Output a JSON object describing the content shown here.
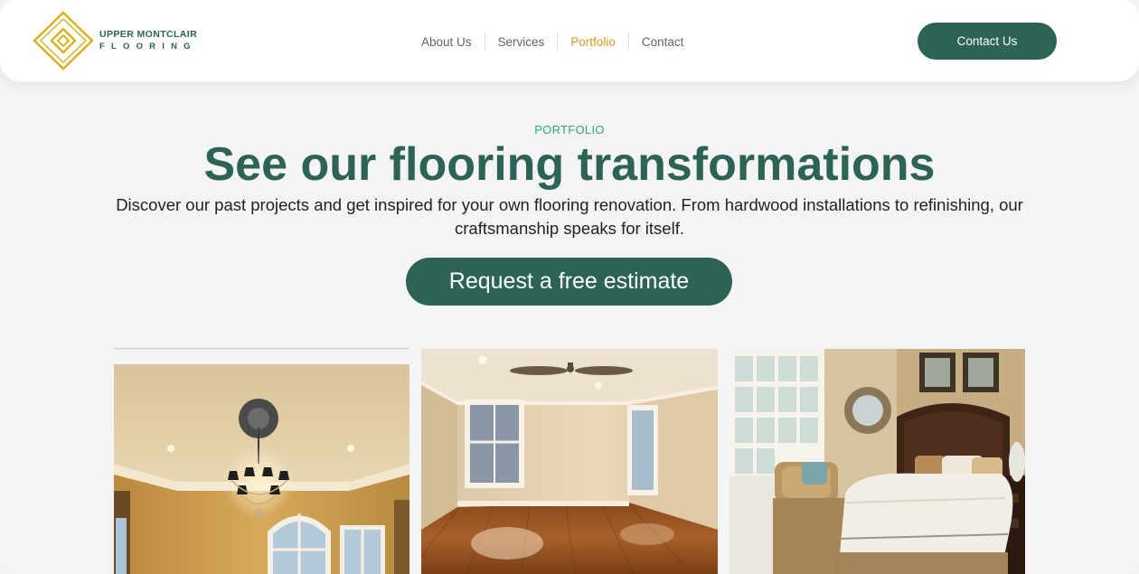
{
  "brand": {
    "line1": "UPPER MONTCLAIR",
    "line2": "FLOORING",
    "logo_color": "#d9b122",
    "text_color": "#2b6254"
  },
  "nav": {
    "items": [
      {
        "label": "About Us",
        "active": false
      },
      {
        "label": "Services",
        "active": false
      },
      {
        "label": "Portfolio",
        "active": true
      },
      {
        "label": "Contact",
        "active": false
      }
    ],
    "active_color": "#d99b1c"
  },
  "header_button": {
    "label": "Contact Us"
  },
  "hero": {
    "eyebrow": "PORTFOLIO",
    "title": "See our flooring transformations",
    "subtitle": "Discover our past projects and get inspired for your own flooring renovation. From hardwood installations to refinishing, our craftsmanship speaks for itself.",
    "cta_label": "Request a free estimate"
  },
  "colors": {
    "primary": "#2d6256",
    "accent_green": "#2fa58a",
    "background": "#f4f4f4"
  },
  "gallery": {
    "photos": [
      {
        "icon": "dining-room-chandelier-photo"
      },
      {
        "icon": "empty-room-hardwood-floor-photo"
      },
      {
        "icon": "bedroom-photo"
      }
    ]
  }
}
